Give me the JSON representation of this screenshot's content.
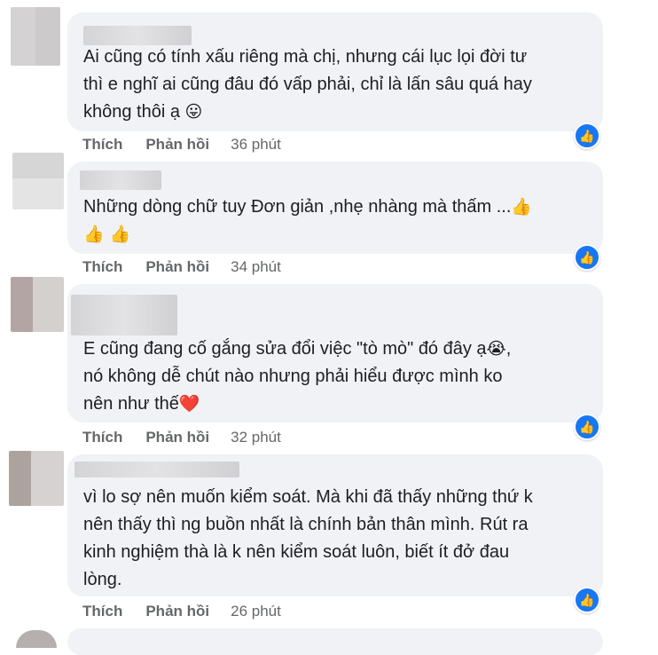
{
  "actions": {
    "like": "Thích",
    "reply": "Phản hồi"
  },
  "comments": [
    {
      "text": "Ai cũng có tính xấu riêng mà chị, nhưng cái lục lọi đời tư\nthì e nghĩ ai cũng đâu đó vấp phải, chỉ là lấn sâu quá hay\nkhông thôi ạ",
      "emoji": "😛",
      "time": "36 phút"
    },
    {
      "text": "Những dòng chữ tuy Đơn giản ,nhẹ nhàng mà thấm ...",
      "emoji": "👍",
      "emoji_line2": "👍 👍",
      "time": "34 phút"
    },
    {
      "text": "E cũng đang cố gắng sửa đổi việc \"tò mò\" đó đây ạ",
      "emoji": "😭",
      "text2": "nó không dễ chút nào nhưng phải hiểu được mình ko\nnên như thế",
      "emoji2": "❤️",
      "time": "32 phút"
    },
    {
      "text": "vì lo sợ nên muốn kiểm soát. Mà khi đã thấy những thứ k\nnên thấy thì ng buồn nhất là chính bản thân mình. Rút ra\nkinh nghiệm thà là k nên kiểm soát luôn, biết ít đở đau\nlòng.",
      "time": "26 phút"
    }
  ],
  "icons": {
    "like_badge": "thumbs-up-icon"
  },
  "colors": {
    "bubble": "#f0f2f5",
    "like_badge": "#1877f2",
    "action_text": "#65676b"
  }
}
